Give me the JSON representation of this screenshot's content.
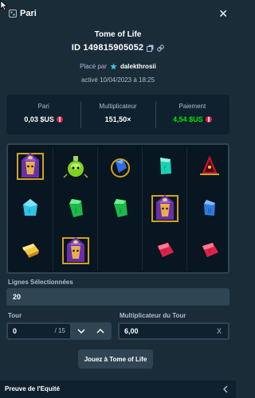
{
  "header": {
    "title": "Pari",
    "icon": "bet-ticket-icon",
    "close_icon": "close-icon"
  },
  "bet": {
    "game_title": "Tome of Life",
    "id_text": "ID 149815905052",
    "placed_by_prefix": "Placé par",
    "username": "dalekthrosii",
    "activated_text": "activé 10/04/2023 à 18:25"
  },
  "stats": {
    "bet_label": "Pari",
    "bet_value": "0,03 $US",
    "multiplier_label": "Multiplicateur",
    "multiplier_value": "151,50×",
    "payout_label": "Paiement",
    "payout_value": "4,54 $US"
  },
  "reels": [
    [
      "pharaoh",
      "blue-gem",
      "yellow-gem"
    ],
    [
      "green-potion",
      "green-gem",
      "pharaoh"
    ],
    [
      "blue-scarab",
      "green-gem",
      "blank"
    ],
    [
      "teal-gem",
      "pharaoh",
      "red-gem"
    ],
    [
      "red-hood",
      "blue-gem",
      "red-gem"
    ]
  ],
  "form": {
    "lines_label": "Lignes Sélectionnées",
    "lines_value": "20",
    "turn_label": "Tour",
    "turn_value": "0",
    "turn_max": "/ 15",
    "round_multiplier_label": "Multiplicateur du Tour",
    "round_multiplier_value": "6,00",
    "round_multiplier_suffix": "X"
  },
  "play_button": "Jouez à Tome of Life",
  "footer": {
    "label": "Preuve de l'Equité"
  },
  "colors": {
    "background": "#1a2c38",
    "panel": "#0f212e",
    "input": "#2f4553",
    "payout_green": "#00e701",
    "coin_red": "#e0224a"
  }
}
